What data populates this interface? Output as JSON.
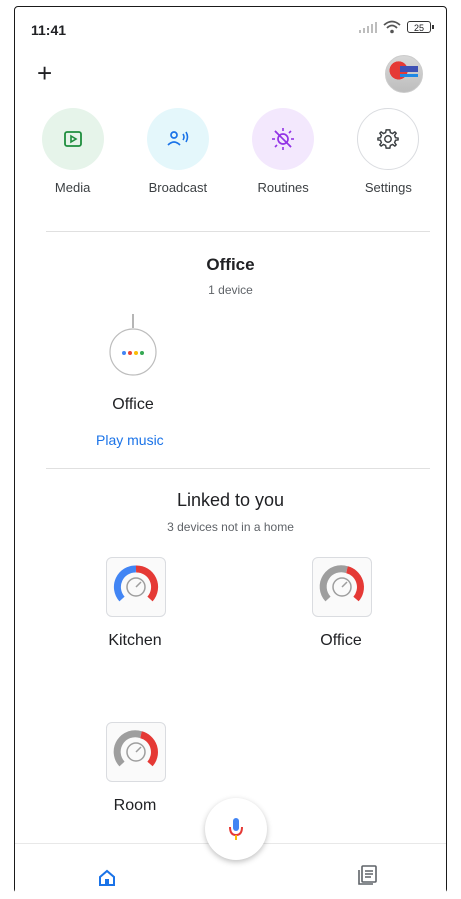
{
  "status_bar": {
    "time": "11:41",
    "battery": "25"
  },
  "header": {
    "add_icon": "plus-icon",
    "avatar": "account-avatar"
  },
  "shortcuts": [
    {
      "label": "Media",
      "icon": "media-play-icon",
      "bg": "#e6f4ea",
      "color": "#1e8e3e"
    },
    {
      "label": "Broadcast",
      "icon": "broadcast-icon",
      "bg": "#e4f7fb",
      "color": "#1a73e8"
    },
    {
      "label": "Routines",
      "icon": "routines-icon",
      "bg": "#f3e8fd",
      "color": "#9334e6"
    },
    {
      "label": "Settings",
      "icon": "gear-icon",
      "bg": "#ffffff",
      "color": "#3c4043"
    }
  ],
  "home": {
    "title": "Office",
    "subtitle": "1 device",
    "device_name": "Office",
    "play_label": "Play music"
  },
  "linked": {
    "title": "Linked to you",
    "subtitle": "3 devices not in a home",
    "devices": [
      "Kitchen",
      "Office",
      "Room"
    ]
  },
  "colors": {
    "accent": "#1a73e8",
    "red": "#e53935",
    "blue": "#4285f4",
    "grey": "#9e9e9e"
  }
}
